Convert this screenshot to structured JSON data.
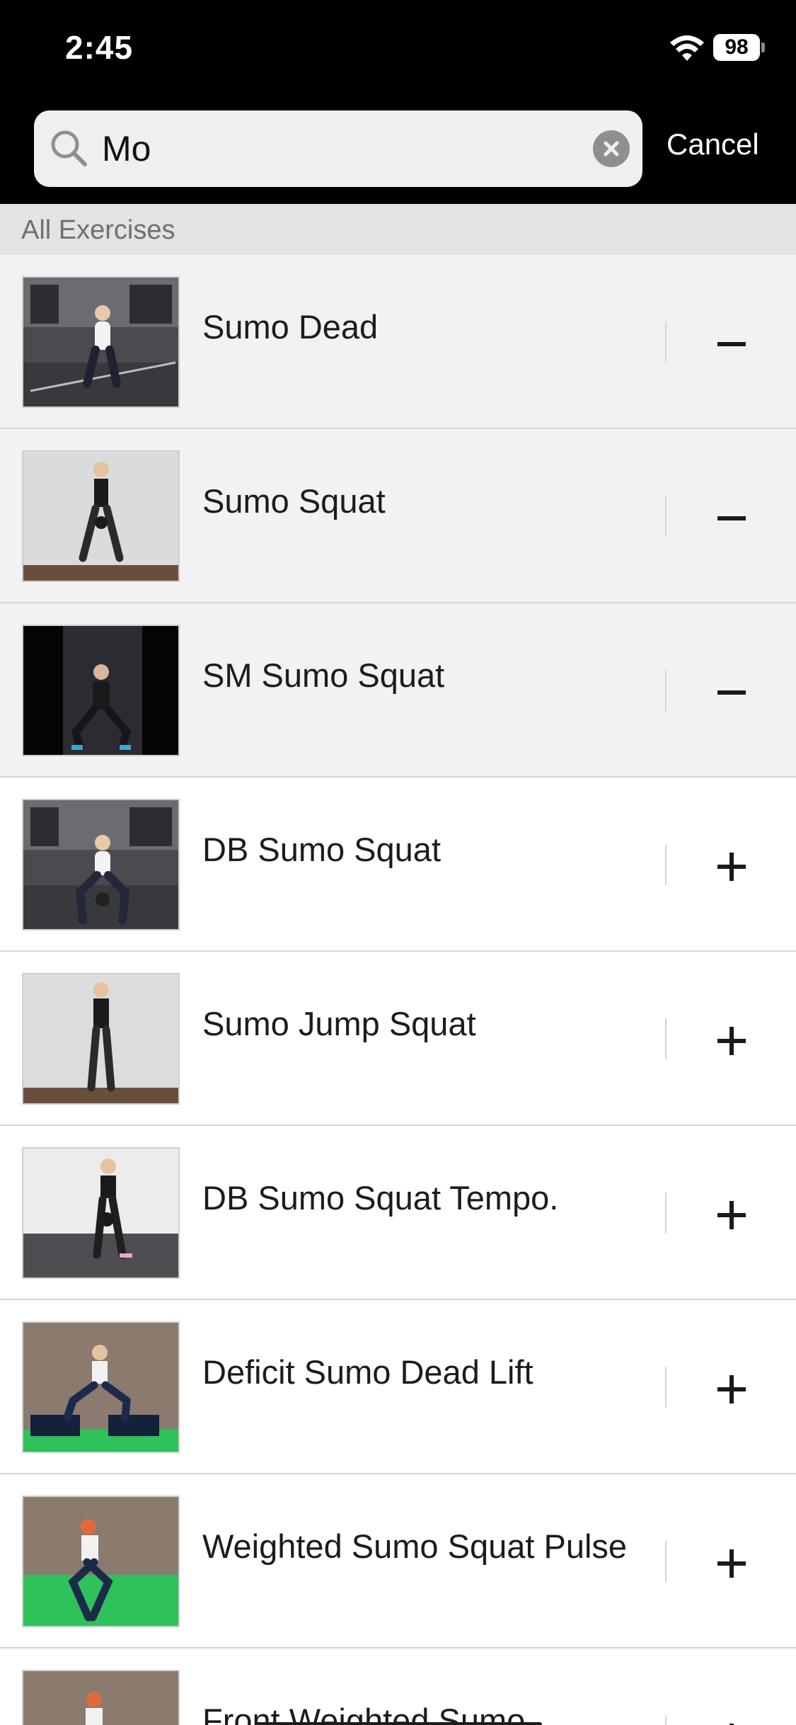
{
  "status_bar": {
    "time": "2:45",
    "battery": "98"
  },
  "search": {
    "value": "Mo",
    "cancel_label": "Cancel"
  },
  "section": {
    "title": "All Exercises"
  },
  "exercises": [
    {
      "name": "Sumo Dead",
      "action": "remove"
    },
    {
      "name": "Sumo Squat",
      "action": "remove"
    },
    {
      "name": "SM Sumo Squat",
      "action": "remove"
    },
    {
      "name": "DB Sumo Squat",
      "action": "add"
    },
    {
      "name": "Sumo Jump Squat",
      "action": "add"
    },
    {
      "name": "DB Sumo Squat Tempo.",
      "action": "add"
    },
    {
      "name": "Deficit Sumo Dead Lift",
      "action": "add"
    },
    {
      "name": "Weighted Sumo Squat Pulse",
      "action": "add"
    },
    {
      "name": "Front Weighted Sumo",
      "action": "add"
    }
  ]
}
